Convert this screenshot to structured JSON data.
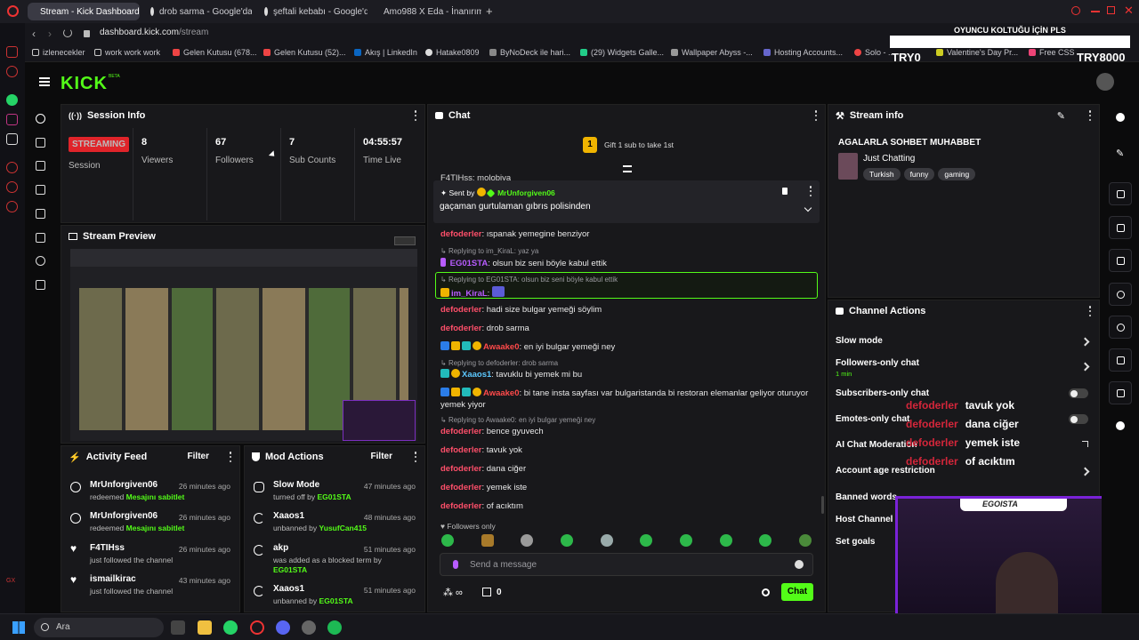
{
  "browser": {
    "tabs": [
      {
        "label": "Stream - Kick Dashboard",
        "active": true
      },
      {
        "label": "drob sarma - Google'da A",
        "active": false
      },
      {
        "label": "şeftali kebabı - Google'da",
        "active": false
      },
      {
        "label": "Amo988 X Eda - İnanırım",
        "active": false
      }
    ],
    "new_tab": "+",
    "address_domain": "dashboard.kick.com",
    "address_path": "/stream",
    "bookmarks": [
      "izlenecekler",
      "work work work",
      "Gelen Kutusu (678...",
      "Gelen Kutusu (52)...",
      "Akış | LinkedIn",
      "Hatake0809",
      "ByNoDeck ile hari...",
      "(29) Widgets Galle...",
      "Wallpaper Abyss -...",
      "Hosting Accounts...",
      "Solo - ...",
      "Valentine's Day Pr...",
      "Free CSS ..."
    ]
  },
  "overlay_top": {
    "banner": "OYUNCU KOLTUĞU İÇİN PLS",
    "left": "TRY0",
    "right": "TRY8000"
  },
  "kick": {
    "logo": "KICK",
    "beta": "BETA"
  },
  "session": {
    "title": "Session Info",
    "badge": "STREAMING",
    "badge_label": "Session",
    "stats": [
      {
        "value": "8",
        "label": "Viewers"
      },
      {
        "value": "67",
        "label": "Followers"
      },
      {
        "value": "7",
        "label": "Sub Counts"
      },
      {
        "value": "04:55:57",
        "label": "Time Live"
      }
    ]
  },
  "preview": {
    "title": "Stream Preview"
  },
  "activity": {
    "title": "Activity Feed",
    "filter": "Filter",
    "items": [
      {
        "name": "MrUnforgiven06",
        "sub": "redeemed",
        "highlight": "Mesajını sabitlet",
        "time": "26 minutes ago"
      },
      {
        "name": "MrUnforgiven06",
        "sub": "redeemed",
        "highlight": "Mesajını sabitlet",
        "time": "26 minutes ago"
      },
      {
        "name": "F4TIHss",
        "sub": "just followed the channel",
        "highlight": "",
        "time": "26 minutes ago"
      },
      {
        "name": "ismailkirac",
        "sub": "just followed the channel",
        "highlight": "",
        "time": "43 minutes ago"
      }
    ]
  },
  "mod": {
    "title": "Mod Actions",
    "filter": "Filter",
    "items": [
      {
        "name": "Slow Mode",
        "sub": "turned off by",
        "highlight": "EG01STA",
        "time": "47 minutes ago"
      },
      {
        "name": "Xaaos1",
        "sub": "unbanned by",
        "highlight": "YusufCan415",
        "time": "48 minutes ago"
      },
      {
        "name": "akp",
        "sub": "was added as a blocked term by",
        "highlight": "EG01STA",
        "time": "51 minutes ago"
      },
      {
        "name": "Xaaos1",
        "sub": "unbanned by",
        "highlight": "EG01STA",
        "time": "51 minutes ago"
      }
    ]
  },
  "chat": {
    "title": "Chat",
    "gift_count": "1",
    "gift_text": "Gift 1 sub to take 1st",
    "partial_top": "F4TIHss: molobiya",
    "pinned_label": "Sent by",
    "pinned_user": "MrUnforgiven06",
    "pinned_msg": "gaçaman gurtulaman gıbrıs polisinden",
    "lines": [
      {
        "type": "msg",
        "user": "defoderler",
        "text": ": ıspanak yemegine benziyor"
      },
      {
        "type": "reply",
        "text": "Replying to im_KiraL: yaz ya"
      },
      {
        "type": "msg2",
        "user": "EG01STA",
        "text": ": olsun biz seni böyle kabul ettik"
      },
      {
        "type": "reply",
        "text": "Replying to EG01STA: olsun biz seni böyle kabul ettik"
      },
      {
        "type": "msg3",
        "user": "im_KiraL",
        "text": ":"
      },
      {
        "type": "msg",
        "user": "defoderler",
        "text": ": hadi size bulgar yemeği söylim"
      },
      {
        "type": "msg",
        "user": "defoderler",
        "text": ": drob sarma"
      },
      {
        "type": "msg4",
        "user": "Awaake0",
        "text": ": en iyi bulgar yemeği ney"
      },
      {
        "type": "reply",
        "text": "Replying to defoderler: drob sarma"
      },
      {
        "type": "msg5",
        "user": "Xaaos1",
        "text": ": tavuklu bi yemek mi bu"
      },
      {
        "type": "msg4",
        "user": "Awaake0",
        "text": ": bi tane insta sayfası var bulgaristanda bi restoran elemanlar geliyor oturuyor"
      },
      {
        "type": "cont",
        "text": "yemek yiyor"
      },
      {
        "type": "reply",
        "text": "Replying to Awaake0: en iyi bulgar yemeği ney"
      },
      {
        "type": "msg",
        "user": "defoderler",
        "text": ": bence gyuvech"
      },
      {
        "type": "msg",
        "user": "defoderler",
        "text": ": tavuk yok"
      },
      {
        "type": "msg",
        "user": "defoderler",
        "text": ": dana ciğer"
      },
      {
        "type": "msg",
        "user": "defoderler",
        "text": ": yemek iste"
      },
      {
        "type": "msg",
        "user": "defoderler",
        "text": ": of acıktım"
      }
    ],
    "followers_only": "Followers only",
    "input_placeholder": "Send a message",
    "points": "0",
    "send": "Chat"
  },
  "stream_info": {
    "title": "Stream info",
    "stream_title": "AGALARLA SOHBET MUHABBET",
    "category": "Just Chatting",
    "tags": [
      "Turkish",
      "funny",
      "gaming"
    ]
  },
  "channel_actions": {
    "title": "Channel Actions",
    "rows": [
      {
        "label": "Slow mode",
        "sub": "",
        "kind": "chevron"
      },
      {
        "label": "Followers-only chat",
        "sub": "1 min",
        "kind": "chevron"
      },
      {
        "label": "Subscribers-only chat",
        "sub": "",
        "kind": "toggle"
      },
      {
        "label": "Emotes-only chat",
        "sub": "",
        "kind": "toggle"
      },
      {
        "label": "AI Chat Moderation",
        "sub": "",
        "kind": "link"
      },
      {
        "label": "Account age restriction",
        "sub": "",
        "kind": "chevron"
      },
      {
        "label": "Banned words",
        "sub": "",
        "kind": "chevron"
      },
      {
        "label": "Host Channel",
        "sub": "",
        "kind": "none"
      },
      {
        "label": "Set goals",
        "sub": "",
        "kind": "none"
      }
    ]
  },
  "overlay_chat": [
    {
      "user": "defoderler",
      "text": "tavuk yok"
    },
    {
      "user": "defoderler",
      "text": "dana ciğer"
    },
    {
      "user": "defoderler",
      "text": "yemek iste"
    },
    {
      "user": "defoderler",
      "text": "of acıktım"
    }
  ],
  "webcam": {
    "name": "EGOISTA"
  },
  "taskbar": {
    "search": "Ara"
  },
  "colors": {
    "accent": "#53fc18",
    "live": "#e0242a",
    "chat_user": "#ff4f6a"
  }
}
